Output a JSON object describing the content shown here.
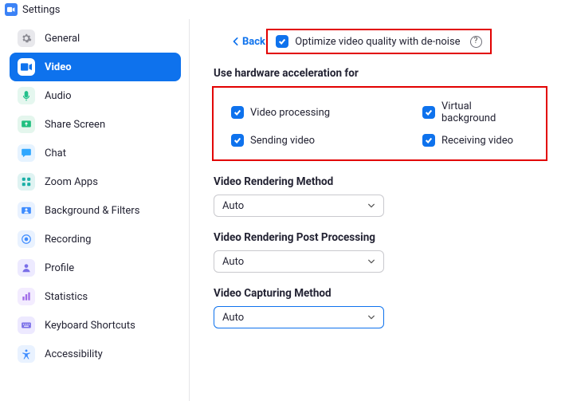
{
  "window": {
    "title": "Settings"
  },
  "sidebar": {
    "items": [
      {
        "label": "General",
        "iconBg": "#e8e8ec",
        "iconFg": "#8a8a92",
        "icon": "gear"
      },
      {
        "label": "Video",
        "iconBg": "#ffffff",
        "iconFg": "#0e72ed",
        "icon": "video",
        "active": true
      },
      {
        "label": "Audio",
        "iconBg": "#e5f7ef",
        "iconFg": "#22c08b",
        "icon": "audio"
      },
      {
        "label": "Share Screen",
        "iconBg": "#e4f6ed",
        "iconFg": "#1fbf7f",
        "icon": "share"
      },
      {
        "label": "Chat",
        "iconBg": "#e6f3ff",
        "iconFg": "#2fa7ff",
        "icon": "chat"
      },
      {
        "label": "Zoom Apps",
        "iconBg": "#dff3f2",
        "iconFg": "#1aafa6",
        "icon": "apps"
      },
      {
        "label": "Background & Filters",
        "iconBg": "#e9f2ff",
        "iconFg": "#3e8cff",
        "icon": "bgfilters"
      },
      {
        "label": "Recording",
        "iconBg": "#e9f2ff",
        "iconFg": "#3e8cff",
        "icon": "recording"
      },
      {
        "label": "Profile",
        "iconBg": "#edeaff",
        "iconFg": "#7a6fe8",
        "icon": "profile"
      },
      {
        "label": "Statistics",
        "iconBg": "#f3ecff",
        "iconFg": "#a06be8",
        "icon": "statistics"
      },
      {
        "label": "Keyboard Shortcuts",
        "iconBg": "#ede9ff",
        "iconFg": "#7a6fe8",
        "icon": "keyboard"
      },
      {
        "label": "Accessibility",
        "iconBg": "#e9f2ff",
        "iconFg": "#3e8cff",
        "icon": "accessibility"
      }
    ]
  },
  "content": {
    "back_label": "Back",
    "optimize_label": "Optimize video quality with de-noise",
    "hw_title": "Use hardware acceleration for",
    "hw": {
      "video_processing": "Video processing",
      "virtual_background": "Virtual background",
      "sending_video": "Sending video",
      "receiving_video": "Receiving video"
    },
    "rendering_method": {
      "title": "Video Rendering Method",
      "value": "Auto"
    },
    "post_processing": {
      "title": "Video Rendering Post Processing",
      "value": "Auto"
    },
    "capturing_method": {
      "title": "Video Capturing Method",
      "value": "Auto"
    }
  }
}
